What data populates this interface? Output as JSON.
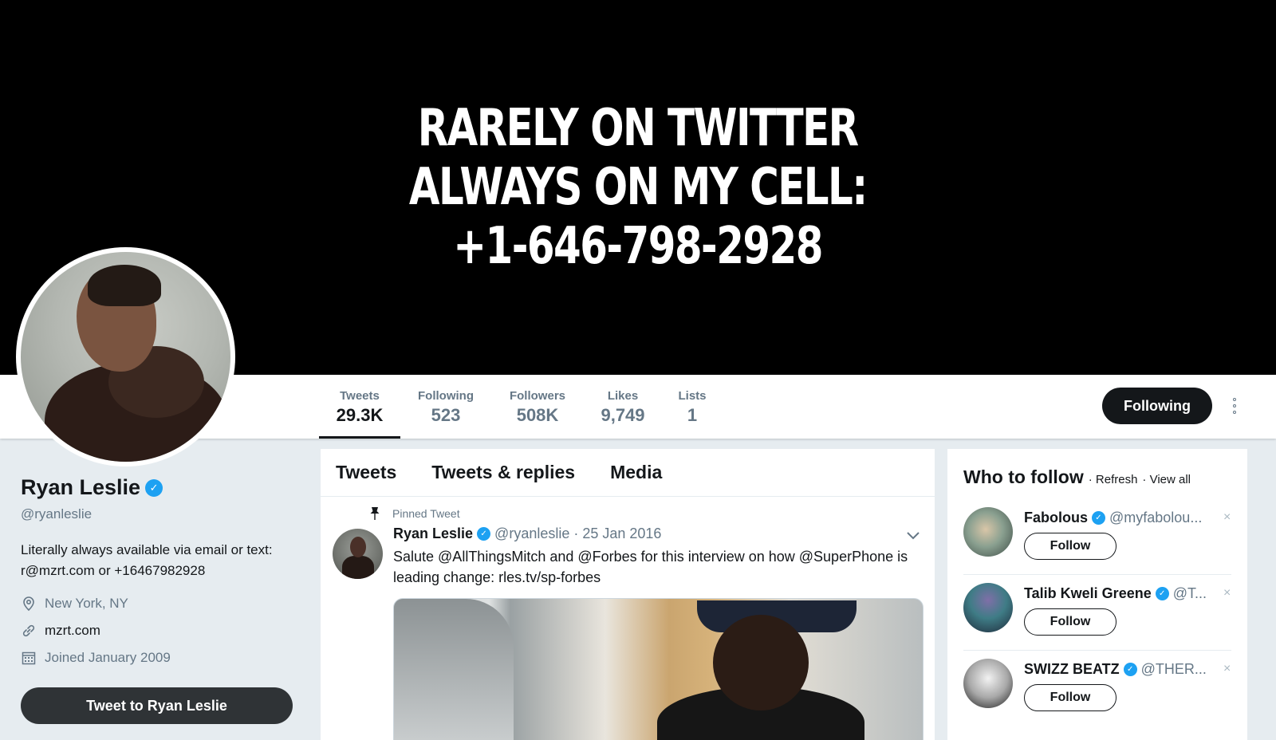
{
  "banner": {
    "line1": "RARELY ON TWITTER",
    "line2": "ALWAYS ON MY CELL:",
    "line3": "+1-646-798-2928"
  },
  "stats": [
    {
      "label": "Tweets",
      "value": "29.3K"
    },
    {
      "label": "Following",
      "value": "523"
    },
    {
      "label": "Followers",
      "value": "508K"
    },
    {
      "label": "Likes",
      "value": "9,749"
    },
    {
      "label": "Lists",
      "value": "1"
    }
  ],
  "actions": {
    "following_label": "Following",
    "tweet_to_label": "Tweet to Ryan Leslie"
  },
  "profile": {
    "name": "Ryan Leslie",
    "handle": "@ryanleslie",
    "bio_line1": "Literally always available via email or text:",
    "bio_line2": "r@mzrt.com or +16467982928",
    "location": "New York, NY",
    "website": "mzrt.com",
    "joined": "Joined January 2009"
  },
  "timeline": {
    "tabs": [
      "Tweets",
      "Tweets & replies",
      "Media"
    ],
    "pinned_label": "Pinned Tweet",
    "tweet": {
      "name": "Ryan Leslie",
      "handle": "@ryanleslie",
      "date": "· 25 Jan 2016",
      "text_line1": "Salute @AllThingsMitch and @Forbes for this interview on how @SuperPhone is",
      "text_line2": "leading change: rles.tv/sp-forbes"
    }
  },
  "who_to_follow": {
    "title": "Who to follow",
    "refresh": "· Refresh",
    "view_all": "· View all",
    "follow_label": "Follow",
    "dismiss": "×",
    "accounts": [
      {
        "name": "Fabolous",
        "handle": "@myfabolou..."
      },
      {
        "name": "Talib Kweli Greene",
        "handle": "@T..."
      },
      {
        "name": "SWIZZ BEATZ",
        "handle": "@THER..."
      }
    ]
  },
  "colors": {
    "accent": "#1da1f2",
    "dark": "#14171a",
    "muted": "#657786",
    "page_bg": "#e6ecf0"
  }
}
